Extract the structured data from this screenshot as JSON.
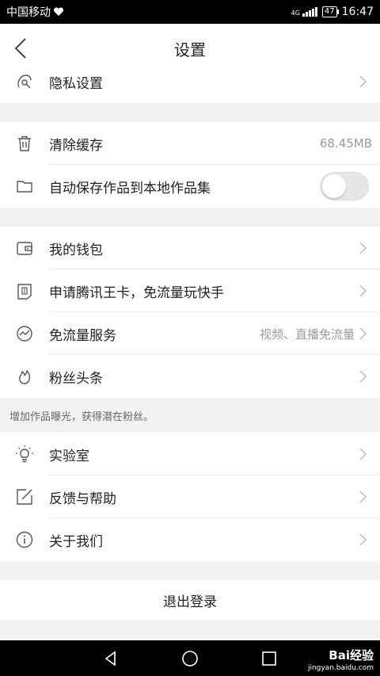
{
  "statusbar": {
    "carrier": "中国移动",
    "network": "4G",
    "battery": "47",
    "time": "16:47"
  },
  "navbar": {
    "title": "设置"
  },
  "sections": [
    [
      {
        "icon": "privacy-icon",
        "label": "隐私设置",
        "chevron": true
      }
    ],
    [
      {
        "icon": "trash-icon",
        "label": "清除缓存",
        "value": "68.45MB"
      },
      {
        "icon": "folder-icon",
        "label": "自动保存作品到本地作品集",
        "toggle": false
      }
    ],
    [
      {
        "icon": "wallet-icon",
        "label": "我的钱包",
        "chevron": true
      },
      {
        "icon": "tencent-card-icon",
        "label": "申请腾讯王卡，免流量玩快手",
        "chevron": true
      },
      {
        "icon": "data-free-icon",
        "label": "免流量服务",
        "value": "视频、直播免流量",
        "chevron": true
      },
      {
        "icon": "flame-icon",
        "label": "粉丝头条",
        "chevron": true
      }
    ],
    [
      {
        "icon": "lightbulb-icon",
        "label": "实验室",
        "chevron": true
      },
      {
        "icon": "feedback-icon",
        "label": "反馈与帮助",
        "chevron": true
      },
      {
        "icon": "info-icon",
        "label": "关于我们",
        "chevron": true
      }
    ]
  ],
  "hint": "增加作品曝光，获得潜在粉丝。",
  "logout": "退出登录",
  "watermark": {
    "brand": "Bai经验",
    "url": "jingyan.baidu.com"
  }
}
